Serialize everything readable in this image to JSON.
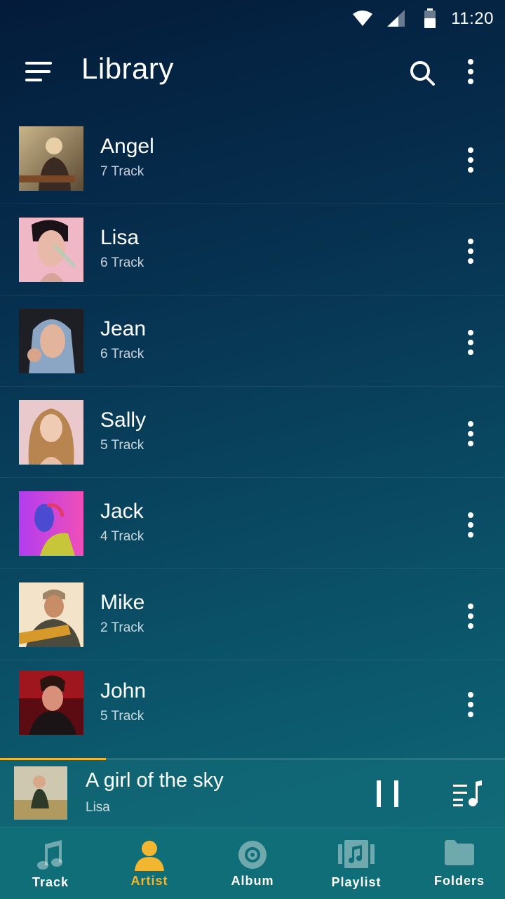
{
  "status_bar": {
    "time": "11:20"
  },
  "header": {
    "title": "Library"
  },
  "artists": [
    {
      "name": "Angel",
      "tracks": "7 Track"
    },
    {
      "name": "Lisa",
      "tracks": "6 Track"
    },
    {
      "name": "Jean",
      "tracks": "6 Track"
    },
    {
      "name": "Sally",
      "tracks": "5 Track"
    },
    {
      "name": "Jack",
      "tracks": "4 Track"
    },
    {
      "name": "Mike",
      "tracks": "2 Track"
    },
    {
      "name": "John",
      "tracks": "5 Track"
    }
  ],
  "now_playing": {
    "title": "A girl of the sky",
    "artist": "Lisa",
    "progress_fraction": 0.21
  },
  "bottom_nav": [
    {
      "label": "Track",
      "icon": "music-note-icon"
    },
    {
      "label": "Artist",
      "icon": "person-icon",
      "active": true
    },
    {
      "label": "Album",
      "icon": "disc-icon"
    },
    {
      "label": "Playlist",
      "icon": "playlist-icon"
    },
    {
      "label": "Folders",
      "icon": "folder-icon"
    }
  ],
  "colors": {
    "accent": "#f2b630",
    "background_top": "#041b3a",
    "background_bottom": "#0f6c7a",
    "nav_bg": "#0f6e77"
  }
}
